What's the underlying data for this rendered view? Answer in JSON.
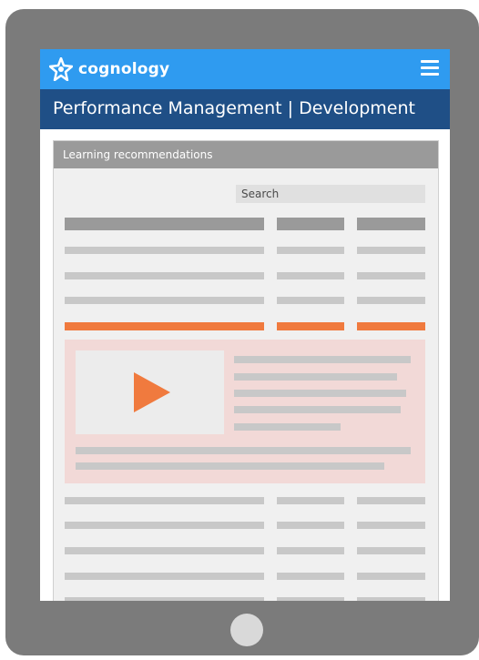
{
  "app": {
    "logo_text": "cognology",
    "menu_icon": "hamburger-menu-icon"
  },
  "titlebar": {
    "title": "Performance Management | Development"
  },
  "panel": {
    "title": "Learning recommendations",
    "search_placeholder": "Search"
  },
  "colors": {
    "topbar": "#2f9bf0",
    "titlebar": "#1f4f86",
    "accent_orange": "#f07a3e",
    "highlight_card": "#f2d9d7"
  },
  "video": {
    "icon": "play-icon"
  }
}
